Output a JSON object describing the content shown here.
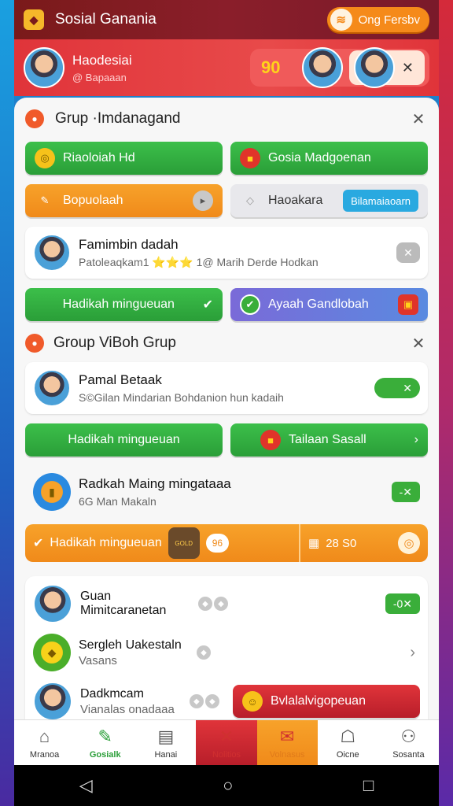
{
  "appbar": {
    "title": "Sosial Ganania",
    "pill_label": "Ong Fersbv"
  },
  "profile": {
    "name": "Haodesiai",
    "handle": "@ Bapaaan",
    "score": "90"
  },
  "group1": {
    "title": "Grup ·Imdanagand",
    "btn_green_left": "Riaoloiah Hd",
    "btn_green_right": "Gosia Madgoenan",
    "btn_orange": "Bopuolaah",
    "btn_grey": "Haoakara",
    "btn_grey_chip": "Bilamaiaoarn",
    "member_name": "Famimbin dadah",
    "member_sub": "Patoleaqkam1 ⭐⭐⭐ 1@ Marih Derde Hodkan",
    "btn_hadikah": "Hadikah mingueuan",
    "btn_purple": "Ayaah Gandlobah"
  },
  "group2": {
    "title": "Group ViBoh Grup",
    "member_name": "Pamal Betaak",
    "member_sub": "S©Gilan Mindarian Bohdanion hun kadaih",
    "toggle_label": "✕",
    "btn_hadikah": "Hadikah mingueuan",
    "btn_sasal": "Tailaan Sasall",
    "item3_name": "Radkah Maing mingataaa",
    "item3_sub": "6G Man Makaln",
    "item3_tag": "-✕",
    "bar_label": "Hadikah mingueuan",
    "bar_tile": "GOLD",
    "bar_pill": "96",
    "bar_score": "28 S0"
  },
  "list": [
    {
      "name": "Guan",
      "sub": "Mimitcaranetan",
      "tag": "-0✕"
    },
    {
      "name": "Sergleh Uakestaln",
      "sub": "Vasans"
    },
    {
      "name": "Dadkmcam",
      "sub": "Vianalas onadaaa",
      "button": "Bvlalalvigopeuan"
    }
  ],
  "bottomnav": [
    {
      "label": "Mranoa",
      "icon": "⌂"
    },
    {
      "label": "Gosialk",
      "icon": "✎"
    },
    {
      "label": "Hanai",
      "icon": "▤"
    },
    {
      "label": "Nolitios",
      "icon": "✕"
    },
    {
      "label": "Volnasus",
      "icon": "✉"
    },
    {
      "label": "Oicne",
      "icon": "☖"
    },
    {
      "label": "Sosanta",
      "icon": "⚇"
    }
  ],
  "colors": {
    "accent_green": "#2a9e38",
    "accent_red": "#e0343a",
    "accent_orange": "#f08a1a"
  }
}
